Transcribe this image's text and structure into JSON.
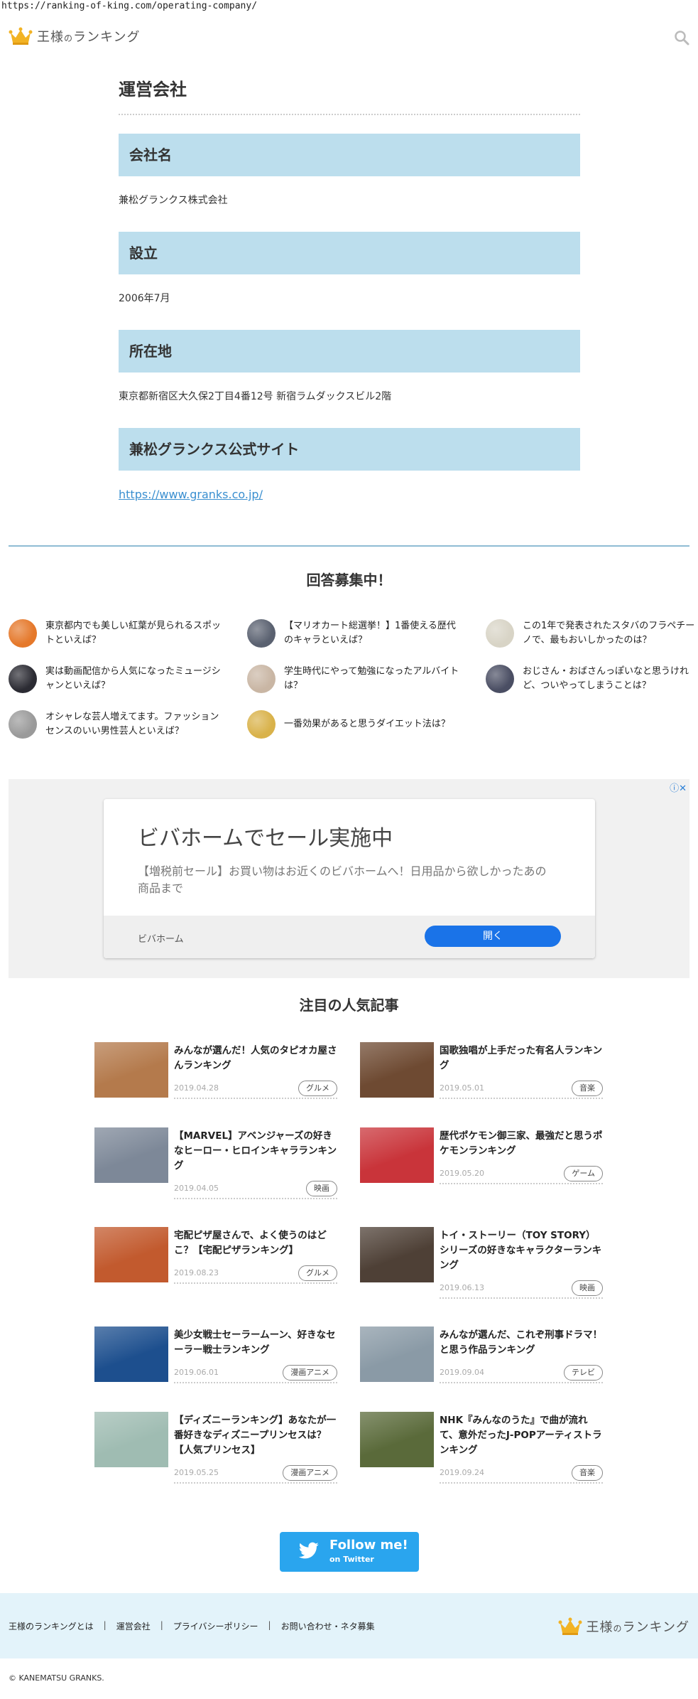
{
  "url": "https://ranking-of-king.com/operating-company/",
  "site": {
    "name_main": "王様",
    "name_small": "の",
    "name_rest": "ランキング"
  },
  "page_title": "運営会社",
  "sections": [
    {
      "heading": "会社名",
      "body": "兼松グランクス株式会社"
    },
    {
      "heading": "設立",
      "body": "2006年7月"
    },
    {
      "heading": "所在地",
      "body": "東京都新宿区大久保2丁目4番12号 新宿ラムダックスビル2階"
    },
    {
      "heading": "兼松グランクス公式サイト",
      "body": "https://www.granks.co.jp/"
    }
  ],
  "questions_title": "回答募集中！",
  "questions": [
    {
      "text": "東京都内でも美しい紅葉が見られるスポットといえば？",
      "color": "#e5782a"
    },
    {
      "text": "【マリオカート総選挙！】1番使える歴代のキャラといえば？",
      "color": "#5a6170"
    },
    {
      "text": "この1年で発表されたスタバのフラペチーノで、最もおいしかったのは？",
      "color": "#d8d4c6"
    },
    {
      "text": "実は動画配信から人気になったミュージシャンといえば？",
      "color": "#2b2b33"
    },
    {
      "text": "学生時代にやって勉強になったアルバイトは？",
      "color": "#c9b6a4"
    },
    {
      "text": "おじさん・おばさんっぽいなと思うけれど、ついやってしまうことは？",
      "color": "#4a4e63"
    },
    {
      "text": "オシャレな芸人増えてます。ファッションセンスのいい男性芸人といえば？",
      "color": "#9a9a9a"
    },
    {
      "text": "一番効果があると思うダイエット法は？",
      "color": "#d9b24a"
    }
  ],
  "ad": {
    "info_icon": "ⓘ✕",
    "title": "ビバホームでセール実施中",
    "description": "【増税前セール】お買い物はお近くのビバホームへ！日用品から欲しかったあの商品まで",
    "brand": "ビバホーム",
    "button": "開く"
  },
  "articles_title": "注目の人気記事",
  "articles": [
    {
      "title": "みんなが選んだ！人気のタピオカ屋さんランキング",
      "date": "2019.04.28",
      "tag": "グルメ",
      "color": "#b47a4c"
    },
    {
      "title": "国歌独唱が上手だった有名人ランキング",
      "date": "2019.05.01",
      "tag": "音楽",
      "color": "#6e4a32"
    },
    {
      "title": "【MARVEL】アベンジャーズの好きなヒーロー・ヒロインキャラランキング",
      "date": "2019.04.05",
      "tag": "映画",
      "color": "#7d8898"
    },
    {
      "title": "歴代ポケモン御三家、最強だと思うポケモンランキング",
      "date": "2019.05.20",
      "tag": "ゲーム",
      "color": "#c9343a"
    },
    {
      "title": "宅配ピザ屋さんで、よく使うのはどこ？【宅配ピザランキング】",
      "date": "2019.08.23",
      "tag": "グルメ",
      "color": "#c25a2e"
    },
    {
      "title": "トイ・ストーリー（TOY STORY）シリーズの好きなキャラクターランキング",
      "date": "2019.06.13",
      "tag": "映画",
      "color": "#4e4036"
    },
    {
      "title": "美少女戦士セーラームーン、好きなセーラー戦士ランキング",
      "date": "2019.06.01",
      "tag": "漫画アニメ",
      "color": "#1d4f8e"
    },
    {
      "title": "みんなが選んだ、これぞ刑事ドラマ！と思う作品ランキング",
      "date": "2019.09.04",
      "tag": "テレビ",
      "color": "#8a9aa6"
    },
    {
      "title": "【ディズニーランキング】あなたが一番好きなディズニープリンセスは？【人気プリンセス】",
      "date": "2019.05.25",
      "tag": "漫画アニメ",
      "color": "#9fbcb2"
    },
    {
      "title": "NHK『みんなのうた』で曲が流れて、意外だったJ-POPアーティストランキング",
      "date": "2019.09.24",
      "tag": "音楽",
      "color": "#5a6a3a"
    }
  ],
  "follow": {
    "main": "Follow me!",
    "sub": "on Twitter"
  },
  "footer_nav": [
    "王様のランキングとは",
    "運営会社",
    "プライバシーポリシー",
    "お問い合わせ・ネタ募集"
  ],
  "copyright": "© KANEMATSU GRANKS."
}
